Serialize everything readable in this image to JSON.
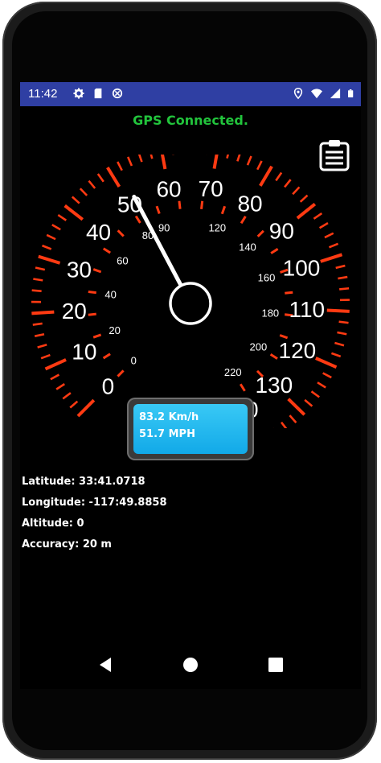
{
  "status_bar": {
    "time": "11:42",
    "left_icons": [
      "gear-icon",
      "sd-card-icon",
      "no-signal-circle-icon"
    ],
    "right_icons": [
      "location-icon",
      "wifi-icon",
      "cell-signal-icon",
      "battery-icon"
    ]
  },
  "gps_status": "GPS Connected.",
  "menu_icon": "clipboard-list-icon",
  "speedometer": {
    "mph_labels": [
      "0",
      "10",
      "20",
      "30",
      "40",
      "50",
      "60",
      "70",
      "80",
      "90",
      "100",
      "110",
      "120",
      "130",
      "140"
    ],
    "kmh_labels": [
      "0",
      "20",
      "40",
      "60",
      "80",
      "90",
      "120",
      "140",
      "160",
      "180",
      "200",
      "220"
    ],
    "needle_mph": 51.7,
    "max_mph": 140,
    "dial_color": "#ff3a12",
    "needle_color": "#ffffff"
  },
  "speed_display": {
    "kmh_text": "83.2 Km/h",
    "mph_text": "51.7 MPH"
  },
  "location": {
    "latitude": "Latitude: 33:41.0718",
    "longitude": "Longitude: -117:49.8858",
    "altitude": "Altitude: 0",
    "accuracy": "Accuracy: 20 m"
  },
  "navbar": {
    "buttons": [
      "back-icon",
      "home-icon",
      "recents-icon"
    ]
  }
}
